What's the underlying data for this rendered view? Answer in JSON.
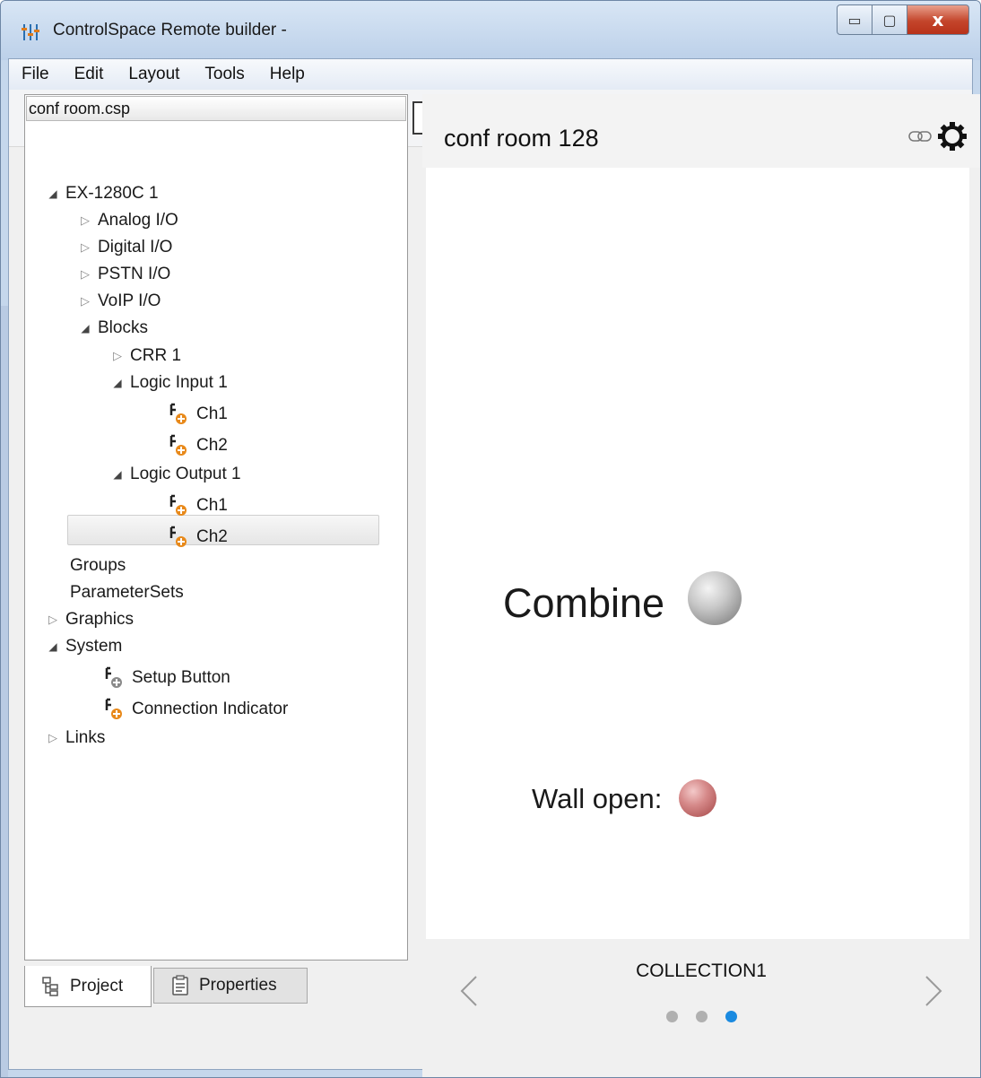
{
  "window": {
    "title": "ControlSpace Remote builder -",
    "minimize_glyph": "▭",
    "maximize_glyph": "▢",
    "close_glyph": "x"
  },
  "menu": [
    "File",
    "Edit",
    "Layout",
    "Tools",
    "Help"
  ],
  "toolbar": {
    "icons": [
      "open-project-icon",
      "new-page-icon",
      "export-page-icon",
      "save-page-icon",
      "cut-icon",
      "copy-icon",
      "paste-icon",
      "delete-icon",
      "undo-icon",
      "redo-icon",
      "remove-page-icon",
      "select-mode-icon",
      "block-settings-icon",
      "page-settings-icon",
      "network-icon",
      "upload-device-icon"
    ],
    "active_tool": "select-mode-icon"
  },
  "tree": {
    "header": "conf room.csp",
    "nodes": [
      {
        "label": "EX-1280C 1",
        "state": "expanded"
      },
      {
        "label": "Analog I/O",
        "state": "collapsed"
      },
      {
        "label": "Digital I/O",
        "state": "collapsed"
      },
      {
        "label": "PSTN I/O",
        "state": "collapsed"
      },
      {
        "label": "VoIP I/O",
        "state": "collapsed"
      },
      {
        "label": "Blocks",
        "state": "expanded"
      },
      {
        "label": "CRR 1",
        "state": "collapsed"
      },
      {
        "label": "Logic Input 1",
        "state": "expanded"
      },
      {
        "label": "Ch1",
        "state": "leaf"
      },
      {
        "label": "Ch2",
        "state": "leaf"
      },
      {
        "label": "Logic Output 1",
        "state": "expanded"
      },
      {
        "label": "Ch1",
        "state": "leaf"
      },
      {
        "label": "Ch2",
        "state": "leaf"
      },
      {
        "label": "Groups",
        "state": "none"
      },
      {
        "label": "ParameterSets",
        "state": "none"
      },
      {
        "label": "Graphics",
        "state": "collapsed"
      },
      {
        "label": "System",
        "state": "expanded"
      },
      {
        "label": "Setup Button",
        "state": "leaf-selected"
      },
      {
        "label": "Connection Indicator",
        "state": "leaf"
      },
      {
        "label": "Links",
        "state": "collapsed"
      }
    ]
  },
  "tabs": {
    "project": "Project",
    "properties": "Properties",
    "active": "Project"
  },
  "preview": {
    "title": "conf room 128",
    "combine_label": "Combine",
    "wall_label": "Wall open:",
    "collection": "COLLECTION1",
    "page_count": 3,
    "active_page": 3,
    "accent": "#1a8ae0"
  }
}
